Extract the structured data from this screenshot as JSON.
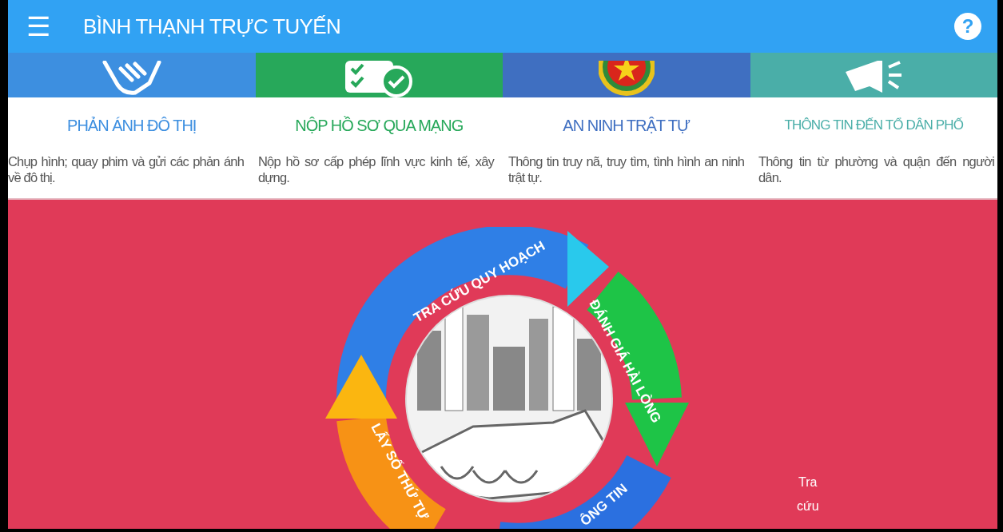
{
  "app_bar": {
    "title": "BÌNH THẠNH TRỰC TUYẾN",
    "menu_icon": "☰",
    "help_icon": "?"
  },
  "services": [
    {
      "kind": "handshake",
      "title": "PHẢN ÁNH ĐÔ THỊ",
      "description": "Chụp hình; quay phim và gửi các phản ánh về đô thị.",
      "color": "#3d8fe0"
    },
    {
      "kind": "checklist",
      "title": "NỘP HỒ SƠ QUA MẠNG",
      "description": "Nộp hồ sơ cấp phép lĩnh vực kinh tế, xây dựng.",
      "color": "#27a85a"
    },
    {
      "kind": "emblem",
      "title": "AN NINH TRẬT TỰ",
      "description": "Thông tin truy nã, truy tìm, tình hình an ninh trật tự.",
      "color": "#3f6fc1"
    },
    {
      "kind": "megaphone",
      "title": "THÔNG TIN ĐẾN TỔ DÂN PHỐ",
      "description": "Thông tin từ phường và quận đến người dân.",
      "color": "#4aaea8"
    }
  ],
  "banner": {
    "cycle_labels": [
      "TRA CỨU QUY HOẠCH",
      "ĐÁNH GIÁ HÀI LÒNG",
      "ÔNG TIN",
      "LẤY SỐ THỨ TỰ"
    ],
    "side_text": [
      "Tra",
      "cứu"
    ]
  }
}
